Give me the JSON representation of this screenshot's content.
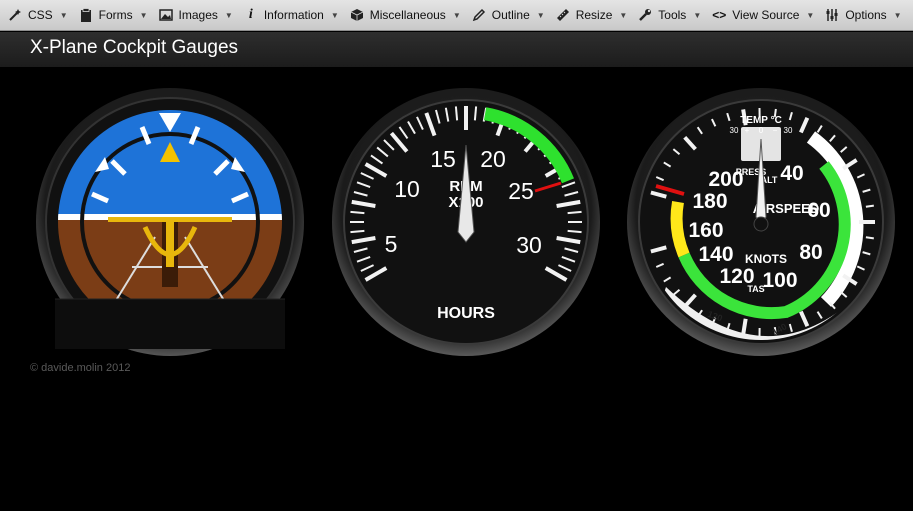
{
  "toolbar": {
    "items": [
      {
        "label": "CSS",
        "icon": "css-wand-icon"
      },
      {
        "label": "Forms",
        "icon": "clipboard-icon"
      },
      {
        "label": "Images",
        "icon": "image-icon"
      },
      {
        "label": "Information",
        "icon": "info-icon"
      },
      {
        "label": "Miscellaneous",
        "icon": "cube-icon"
      },
      {
        "label": "Outline",
        "icon": "pencil-icon"
      },
      {
        "label": "Resize",
        "icon": "ruler-icon"
      },
      {
        "label": "Tools",
        "icon": "wrench-icon"
      },
      {
        "label": "View Source",
        "icon": "code-icon"
      },
      {
        "label": "Options",
        "icon": "sliders-icon"
      }
    ]
  },
  "header": {
    "title": "X-Plane Cockpit Gauges"
  },
  "tachometer": {
    "numbers": [
      "5",
      "10",
      "15",
      "20",
      "25",
      "30"
    ],
    "label_top": "RPM",
    "label_bottom": "X100",
    "footer": "HOURS"
  },
  "airspeed": {
    "numbers": [
      "40",
      "60",
      "80",
      "100",
      "120",
      "140",
      "160",
      "180",
      "200"
    ],
    "title": "AIRSPEED",
    "units": "KNOTS",
    "temp_label": "TEMP °C",
    "temp_scale": [
      "30",
      "+",
      "0",
      "−",
      "30"
    ],
    "press_label": "PRESS",
    "press_alt": "ALT",
    "tas_label": "TAS",
    "tas_numbers": [
      "120",
      "140"
    ]
  },
  "footer": {
    "copyright": "© davide.molin 2012"
  }
}
